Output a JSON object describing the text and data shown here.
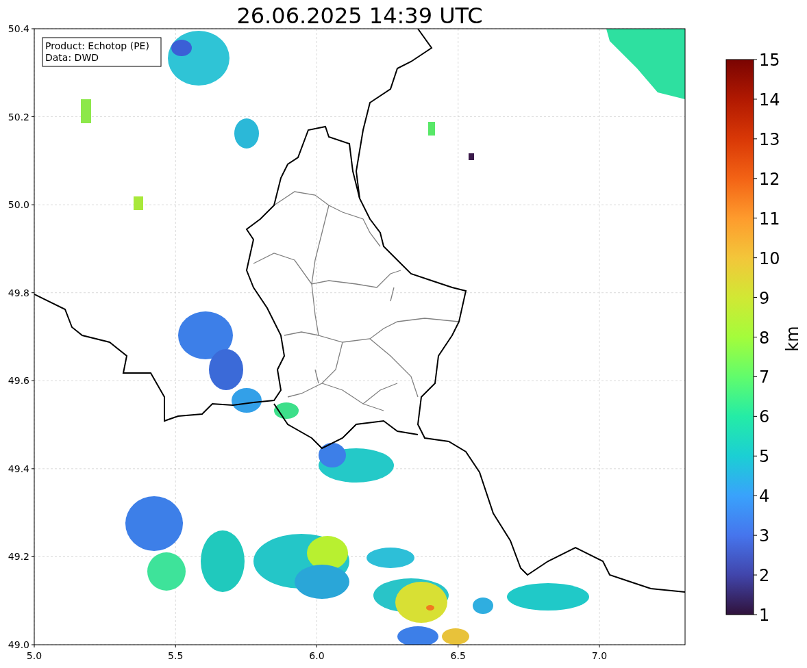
{
  "title": "26.06.2025 14:39 UTC",
  "info_box": {
    "lines": [
      "Product: Echotop (PE)",
      "Data: DWD"
    ]
  },
  "x_axis": {
    "ticks": [
      "5.0",
      "5.5",
      "6.0",
      "6.5",
      "7.0"
    ]
  },
  "y_axis": {
    "ticks": [
      "50.4",
      "50.2",
      "50.0",
      "49.8",
      "49.6",
      "49.4",
      "49.2",
      "49.0"
    ]
  },
  "colorbar": {
    "label": "km",
    "ticks": [
      "15",
      "14",
      "13",
      "12",
      "11",
      "10",
      "9",
      "8",
      "7",
      "6",
      "5",
      "4",
      "3",
      "2",
      "1"
    ]
  }
}
